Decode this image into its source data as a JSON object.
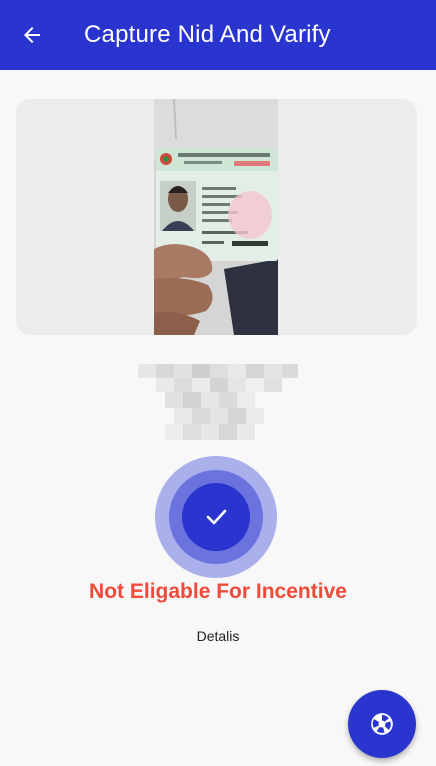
{
  "appbar": {
    "title": "Capture Nid And Varify",
    "back_icon": "arrow-left-icon"
  },
  "colors": {
    "primary": "#2a35d0",
    "status_error": "#f04a3a",
    "ring_outer": "#a9b0ec",
    "ring_mid": "#6b73de"
  },
  "capture": {
    "status_icon": "check-icon",
    "status_text": "Not Eligable For Incentive",
    "details_label": "Detalis"
  },
  "fab": {
    "icon": "camera-shutter-icon"
  }
}
